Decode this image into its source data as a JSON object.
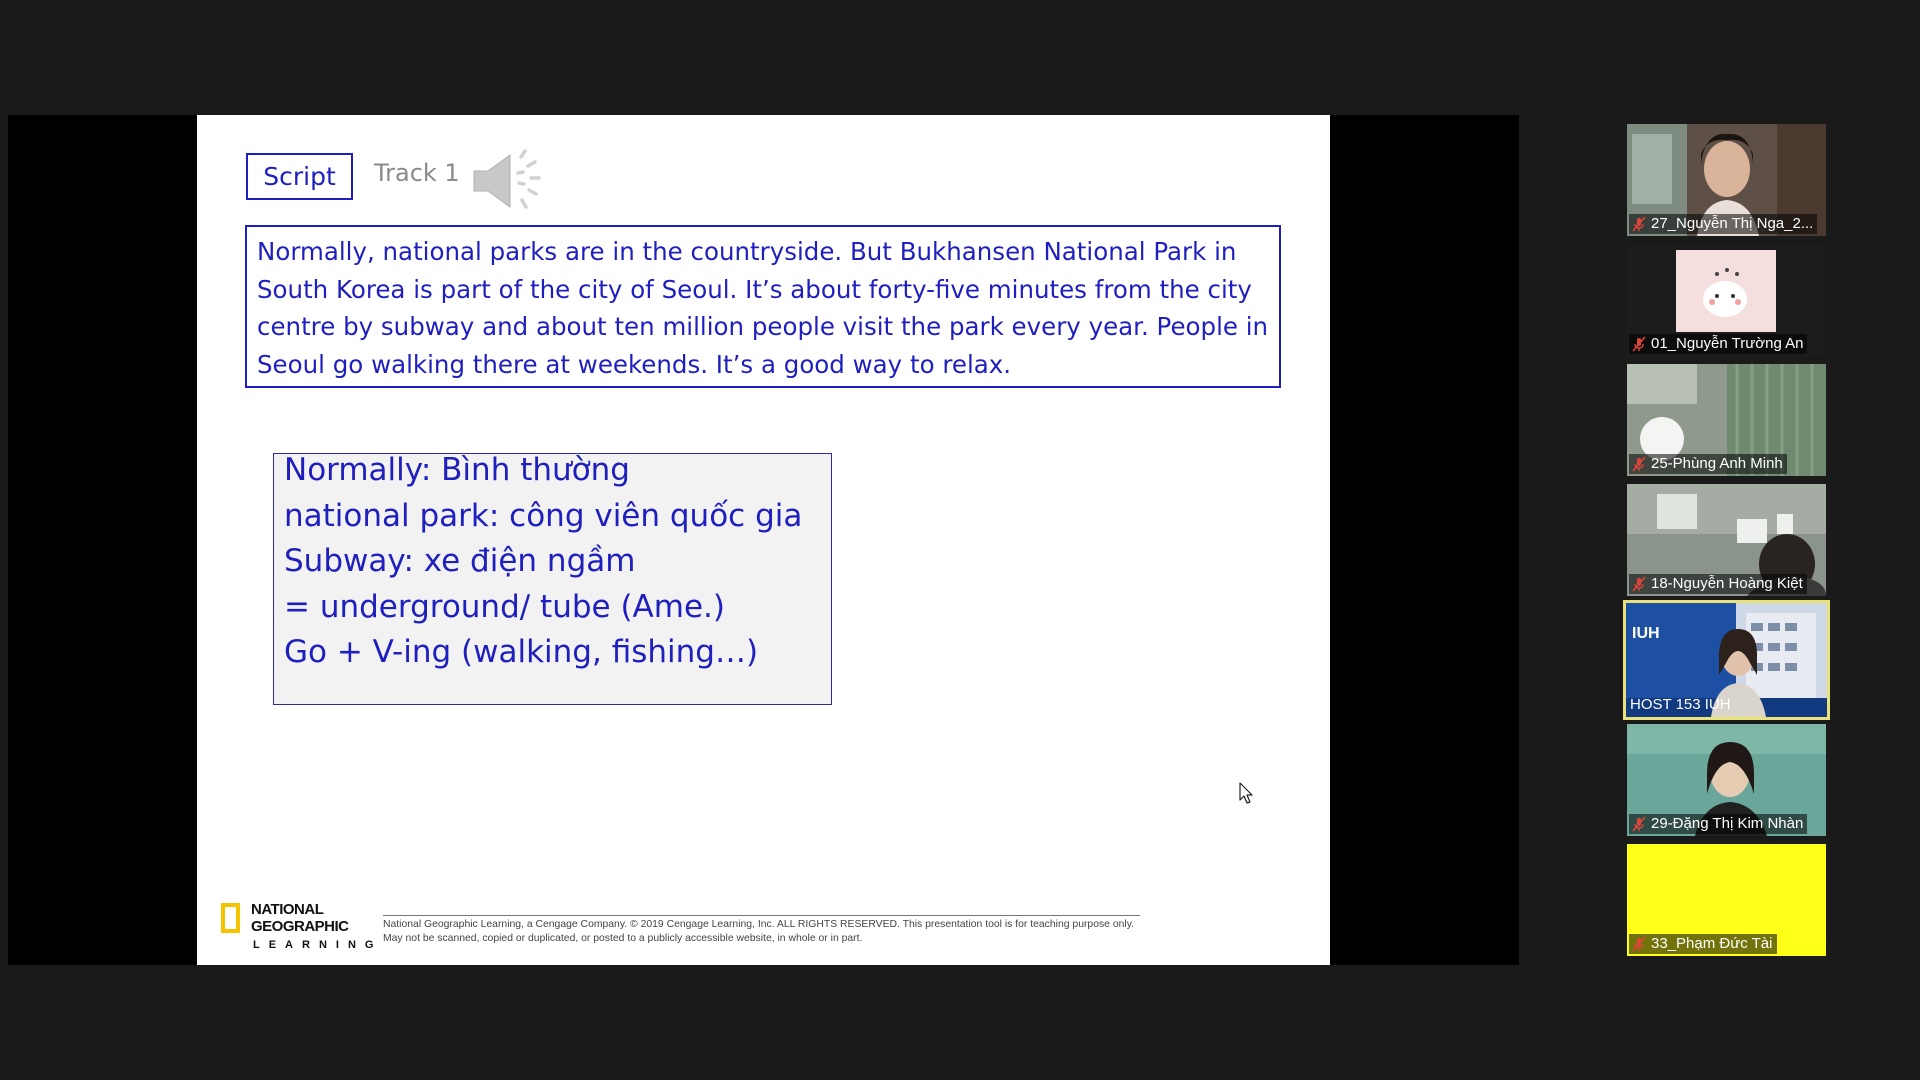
{
  "slide": {
    "script_label": "Script",
    "track_label": "Track 1",
    "script_text": "Normally, national parks are in the countryside. But Bukhansen National Park in South Korea is part of the city of Seoul. It’s about forty-five minutes from the city centre by subway and about ten million people visit the park every year. People in Seoul go walking there at weekends. It’s a good way to relax.",
    "vocab": [
      "Normally: Bình thường",
      "national park: công viên quốc gia",
      "Subway: xe điện ngầm",
      "= underground/ tube (Ame.)",
      "Go + V-ing (walking, fishing…)"
    ],
    "logo": {
      "line1": "NATIONAL",
      "line2": "GEOGRAPHIC",
      "line3": "LEARNING"
    },
    "copyright": "National Geographic Learning, a Cengage Company. © 2019 Cengage Learning, Inc. ALL RIGHTS RESERVED. This presentation tool is for teaching purpose only. May not be scanned, copied or duplicated, or posted to a publicly accessible website, in whole or in part."
  },
  "participants": [
    {
      "name": "27_Nguyễn Thị Nga_2...",
      "muted": true,
      "video": "camera"
    },
    {
      "name": "01_Nguyễn Trường An",
      "muted": true,
      "video": "avatar-image"
    },
    {
      "name": "25-Phùng Anh Minh",
      "muted": true,
      "video": "camera"
    },
    {
      "name": "18-Nguyễn Hoàng Kiệt",
      "muted": true,
      "video": "camera"
    },
    {
      "name": "HOST 153 IUH",
      "muted": false,
      "video": "virtual-background",
      "active_speaker": true,
      "brand_text": "IUH"
    },
    {
      "name": "29-Đặng Thị Kim Nhàn",
      "muted": true,
      "video": "camera"
    },
    {
      "name": "33_Phạm Đức Tài",
      "muted": true,
      "video": "yellow-screen"
    }
  ],
  "colors": {
    "slide_text": "#1f1fbf",
    "active_speaker_border": "#e7e37a",
    "mute_icon": "#e0443a",
    "logo_yellow": "#f5c400"
  }
}
